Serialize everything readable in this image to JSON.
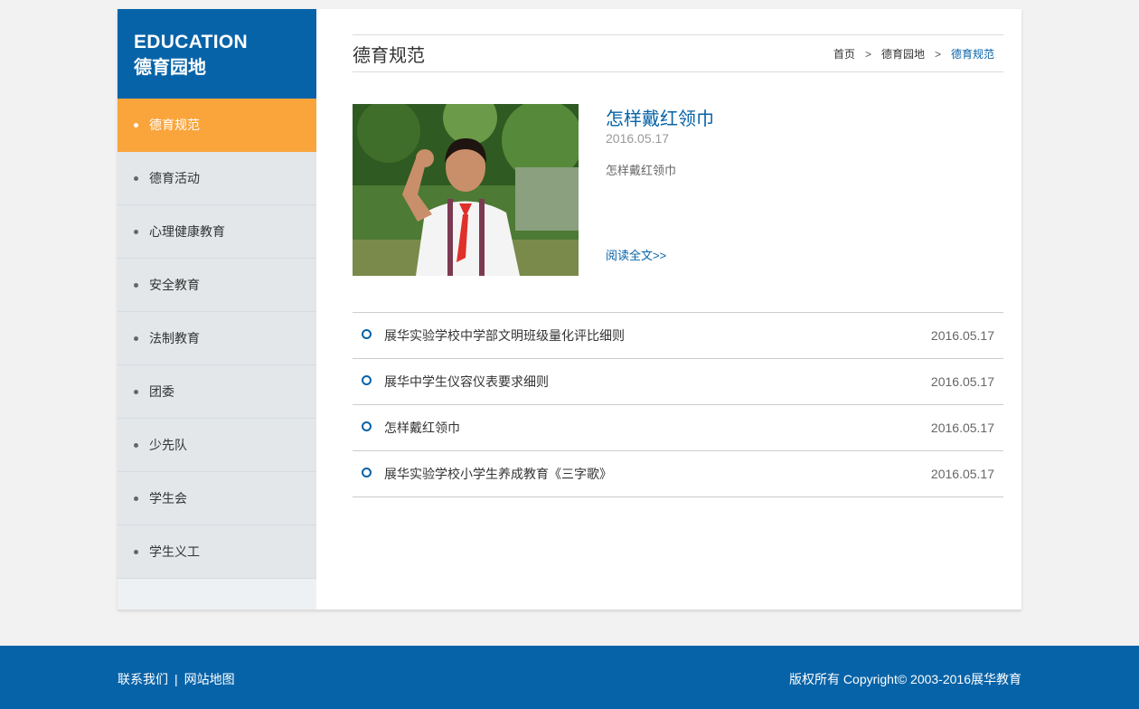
{
  "sidebar": {
    "title_en": "EDUCATION",
    "title_cn": "德育园地",
    "items": [
      {
        "label": "德育规范",
        "active": true
      },
      {
        "label": "德育活动"
      },
      {
        "label": "心理健康教育"
      },
      {
        "label": "安全教育"
      },
      {
        "label": "法制教育"
      },
      {
        "label": "团委"
      },
      {
        "label": "少先队"
      },
      {
        "label": "学生会"
      },
      {
        "label": "学生义工"
      }
    ]
  },
  "header": {
    "page_title": "德育规范",
    "breadcrumb": [
      "首页",
      "德育园地",
      "德育规范"
    ],
    "separator": ">"
  },
  "featured": {
    "title": "怎样戴红领巾",
    "date": "2016.05.17",
    "summary": "怎样戴红领巾",
    "read_more": "阅读全文>>"
  },
  "articles": [
    {
      "title": "展华实验学校中学部文明班级量化评比细则",
      "date": "2016.05.17"
    },
    {
      "title": "展华中学生仪容仪表要求细则",
      "date": "2016.05.17"
    },
    {
      "title": "怎样戴红领巾",
      "date": "2016.05.17"
    },
    {
      "title": "展华实验学校小学生养成教育《三字歌》",
      "date": "2016.05.17"
    }
  ],
  "footer": {
    "contact": "联系我们",
    "divider": "|",
    "sitemap": "网站地图",
    "copyright": "版权所有 Copyright© 2003-2016展华教育"
  },
  "colors": {
    "brand_blue": "#0763a8",
    "accent_orange": "#f9a53c"
  }
}
